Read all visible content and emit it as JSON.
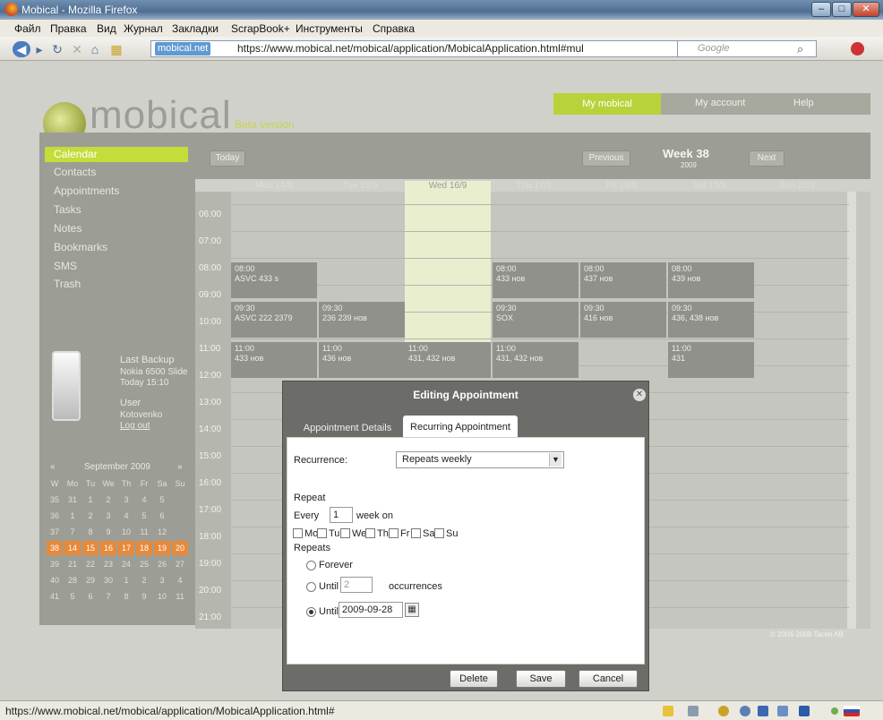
{
  "window": {
    "title": "Mobical - Mozilla Firefox",
    "min": "–",
    "max": "□",
    "close": "✕"
  },
  "menu": [
    "Файл",
    "Правка",
    "Вид",
    "Журнал",
    "Закладки",
    "ScrapBook+",
    "Инструменты",
    "Справка"
  ],
  "browser": {
    "site_badge": "mobical.net",
    "url": "https://www.mobical.net/mobical/application/MobicalApplication.html#mul",
    "search_placeholder": "Google"
  },
  "app": {
    "logo": "mobical",
    "beta": "Beta version",
    "top_nav": [
      "My mobical",
      "My account",
      "Help"
    ]
  },
  "sidebar": {
    "items": [
      "Calendar",
      "Contacts",
      "Appointments",
      "Tasks",
      "Notes",
      "Bookmarks",
      "SMS",
      "Trash"
    ]
  },
  "backup": {
    "title": "Last Backup",
    "device": "Nokia 6500 Slide",
    "when": "Today 15:10",
    "user_label": "User",
    "user": "Kotovenko",
    "logout": "Log out"
  },
  "minical": {
    "month": "September 2009",
    "prev": "«",
    "next": "»",
    "weekdays": [
      "W",
      "Mo",
      "Tu",
      "We",
      "Th",
      "Fr",
      "Sa",
      "Su"
    ],
    "rows": [
      [
        "35",
        "31",
        "1",
        "2",
        "3",
        "4",
        "5"
      ],
      [
        "36",
        "1",
        "2",
        "3",
        "4",
        "5",
        "6"
      ],
      [
        "37",
        "7",
        "8",
        "9",
        "10",
        "11",
        "12"
      ],
      [
        "38",
        "14",
        "15",
        "16",
        "17",
        "18",
        "19",
        "20"
      ],
      [
        "39",
        "21",
        "22",
        "23",
        "24",
        "25",
        "26",
        "27"
      ],
      [
        "40",
        "28",
        "29",
        "30",
        "1",
        "2",
        "3",
        "4"
      ],
      [
        "41",
        "5",
        "6",
        "7",
        "8",
        "9",
        "10",
        "11"
      ]
    ]
  },
  "calendar": {
    "today_btn": "Today",
    "prev_btn": "Previous",
    "next_btn": "Next",
    "week": "Week 38",
    "year": "2009",
    "days": [
      "Mon 14/9",
      "Tue 15/9",
      "Wed 16/9",
      "Thu 17/9",
      "Fri 18/9",
      "Sat 19/9",
      "Sun 20/9"
    ],
    "times": [
      "06:00",
      "07:00",
      "08:00",
      "09:00",
      "10:00",
      "11:00",
      "12:00",
      "13:00",
      "14:00",
      "15:00",
      "16:00",
      "17:00",
      "18:00",
      "19:00",
      "20:00",
      "21:00"
    ],
    "events": [
      {
        "time": "08:00",
        "text": "ASVC 433 s"
      },
      {
        "time": "08:00",
        "text": "433 нов"
      },
      {
        "time": "08:00",
        "text": "437 нов"
      },
      {
        "time": "08:00",
        "text": "439 нов"
      },
      {
        "time": "09:30",
        "text": "ASVC 222 2379"
      },
      {
        "time": "09:30",
        "text": "236 239 нов"
      },
      {
        "time": "09:30",
        "text": "SOX"
      },
      {
        "time": "09:30",
        "text": "416 нов"
      },
      {
        "time": "09:30",
        "text": "436, 438 нов"
      },
      {
        "time": "11:00",
        "text": "433 нов"
      },
      {
        "time": "11:00",
        "text": "436 нов"
      },
      {
        "time": "11:00",
        "text": "431, 432 нов"
      },
      {
        "time": "11:00",
        "text": "431, 432 нов"
      },
      {
        "time": "11:00",
        "text": "431"
      }
    ],
    "copyright": "© 2004-2009 Tactel AB"
  },
  "dialog": {
    "title": "Editing Appointment",
    "tab1": "Appointment Details",
    "tab2": "Recurring Appointment",
    "recurrence_label": "Recurrence:",
    "recurrence_value": "Repeats weekly",
    "repeat": "Repeat",
    "every": "Every",
    "every_value": "1",
    "week_on": "week on",
    "days": [
      "Mo",
      "Tu",
      "We",
      "Th",
      "Fr",
      "Sa",
      "Su"
    ],
    "repeats": "Repeats",
    "forever": "Forever",
    "until": "Until",
    "occ_value": "2",
    "occurrences": "occurrences",
    "until_date": "2009-09-28",
    "delete": "Delete",
    "save": "Save",
    "cancel": "Cancel"
  },
  "status": {
    "url": "https://www.mobical.net/mobical/application/MobicalApplication.html#"
  }
}
